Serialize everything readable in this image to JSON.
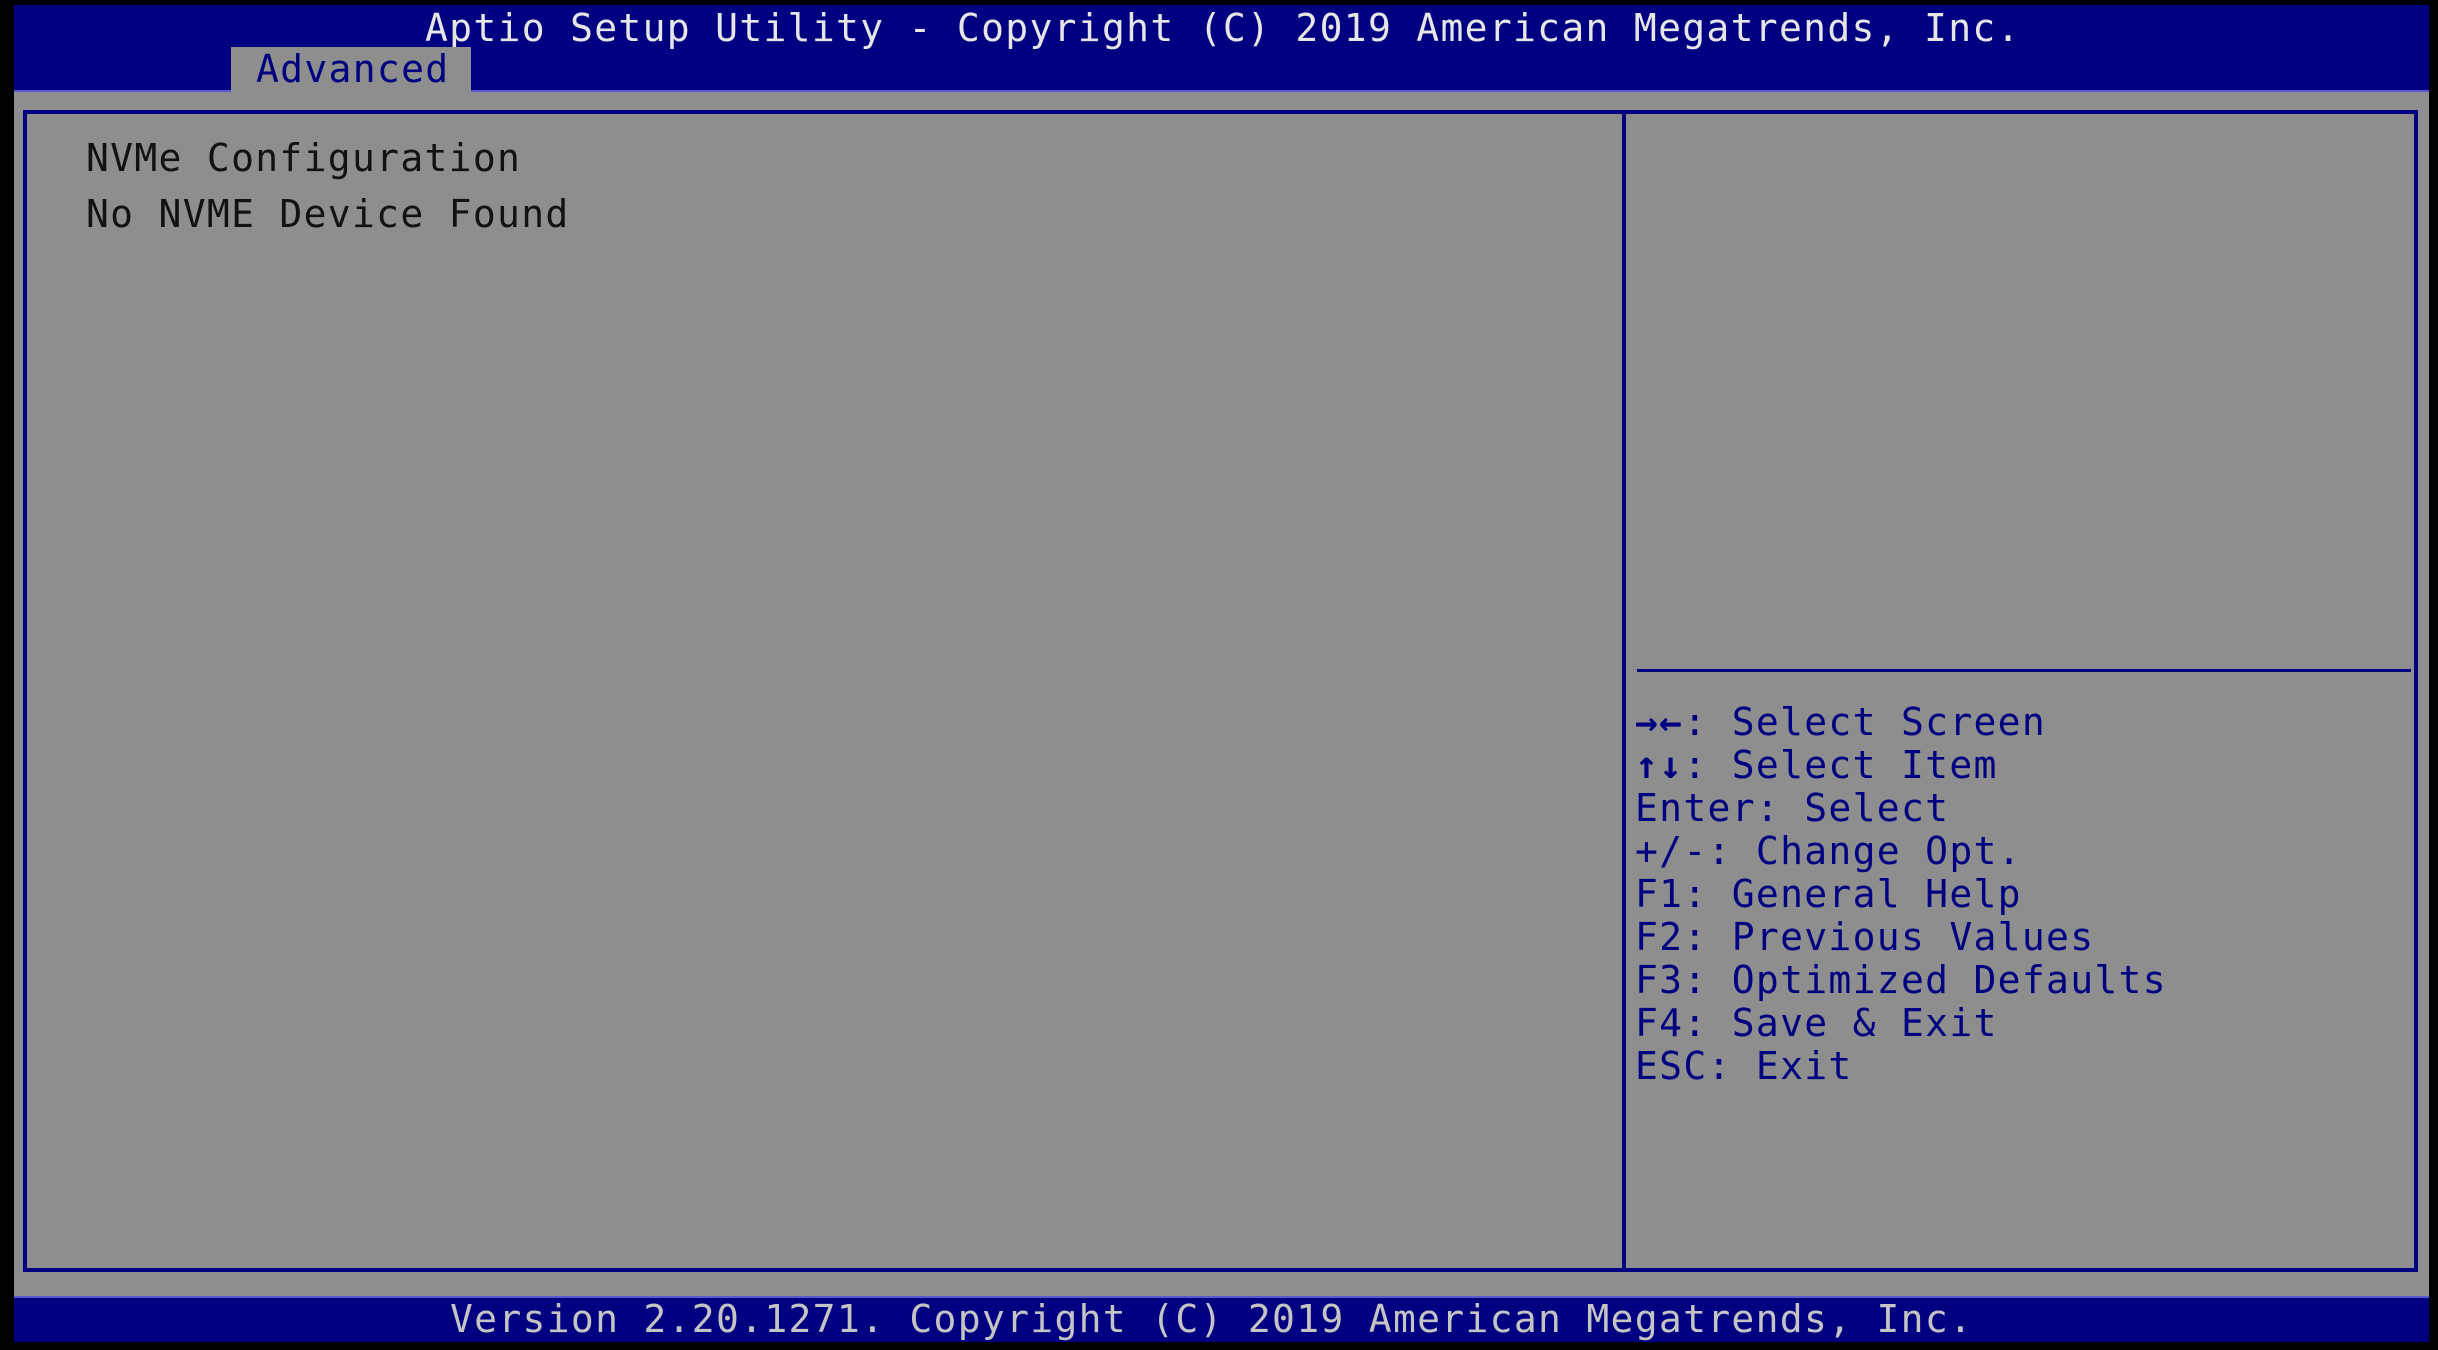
{
  "header": {
    "title": "Aptio Setup Utility - Copyright (C) 2019 American Megatrends, Inc.",
    "tabs": [
      {
        "label": "Advanced",
        "active": true
      }
    ]
  },
  "main": {
    "lines": [
      "NVMe Configuration",
      "No NVME Device Found"
    ]
  },
  "help": {
    "description": "",
    "keys": [
      {
        "key": "→←",
        "icon": "left-right-arrows-icon",
        "action": ": Select Screen"
      },
      {
        "key": "↑↓",
        "icon": "up-down-arrows-icon",
        "action": ": Select Item"
      },
      {
        "key": "Enter",
        "action": ": Select"
      },
      {
        "key": "+/-",
        "action": ": Change Opt."
      },
      {
        "key": "F1",
        "action": ": General Help"
      },
      {
        "key": "F2",
        "action": ": Previous Values"
      },
      {
        "key": "F3",
        "action": ": Optimized Defaults"
      },
      {
        "key": "F4",
        "action": ": Save & Exit"
      },
      {
        "key": "ESC",
        "action": ": Exit"
      }
    ]
  },
  "footer": {
    "text": "Version 2.20.1271. Copyright (C) 2019 American Megatrends, Inc."
  },
  "colors": {
    "header_blue": "#000080",
    "panel_gray": "#8e8e8e",
    "help_text": "#000080",
    "title_text": "#e6e6e6",
    "footer_text": "#c4c4c4"
  }
}
